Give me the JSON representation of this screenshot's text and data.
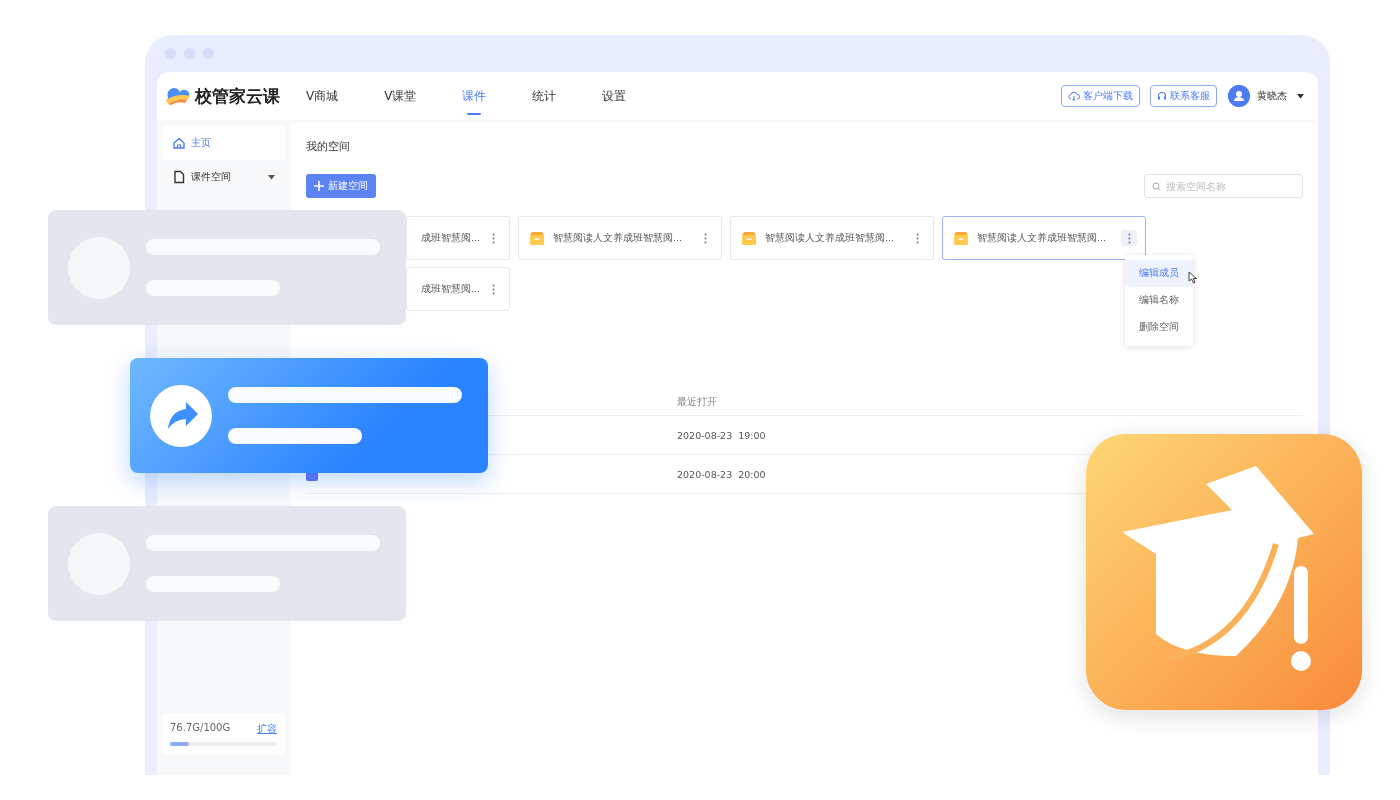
{
  "logo": {
    "text": "校管家云课"
  },
  "nav": [
    {
      "label": "V商城",
      "selected": false
    },
    {
      "label": "V课堂",
      "selected": false
    },
    {
      "label": "课件",
      "selected": true
    },
    {
      "label": "统计",
      "selected": false
    },
    {
      "label": "设置",
      "selected": false
    }
  ],
  "header_buttons": [
    {
      "kind": "download",
      "label": "客户端下载"
    },
    {
      "kind": "support",
      "label": "联系客服"
    }
  ],
  "user": {
    "name": "黄晓杰"
  },
  "sidebar": {
    "items": [
      {
        "kind": "home",
        "label": "主页",
        "selected": true
      },
      {
        "kind": "folder",
        "label": "课件空间",
        "selected": false
      }
    ]
  },
  "storage": {
    "usage": "76.7G/100G",
    "action": "扩容",
    "level": 0.18
  },
  "content": {
    "title": "我的空间",
    "new_button": "新建空间",
    "search": {
      "placeholder": "搜索空间名称"
    }
  },
  "spaces": [
    {
      "kind": "covered",
      "name": "成班智慧阅...",
      "selected": false
    },
    {
      "kind": "full",
      "name": "智慧阅读人文养成班智慧阅...",
      "selected": false
    },
    {
      "kind": "full",
      "name": "智慧阅读人文养成班智慧阅...",
      "selected": false
    },
    {
      "kind": "full",
      "name": "智慧阅读人文养成班智慧阅...",
      "selected": true
    },
    {
      "kind": "covered",
      "name": "成班智慧阅...",
      "selected": false
    }
  ],
  "space_menu": {
    "items": [
      {
        "label": "编辑成员",
        "selected": true
      },
      {
        "label": "编辑名称",
        "selected": false
      },
      {
        "label": "删除空间",
        "selected": false
      }
    ]
  },
  "table": {
    "opened_header": "最近打开",
    "rows": [
      {
        "opened": "2020-08-23  19:00"
      },
      {
        "opened": "2020-08-23  20:00"
      }
    ]
  }
}
